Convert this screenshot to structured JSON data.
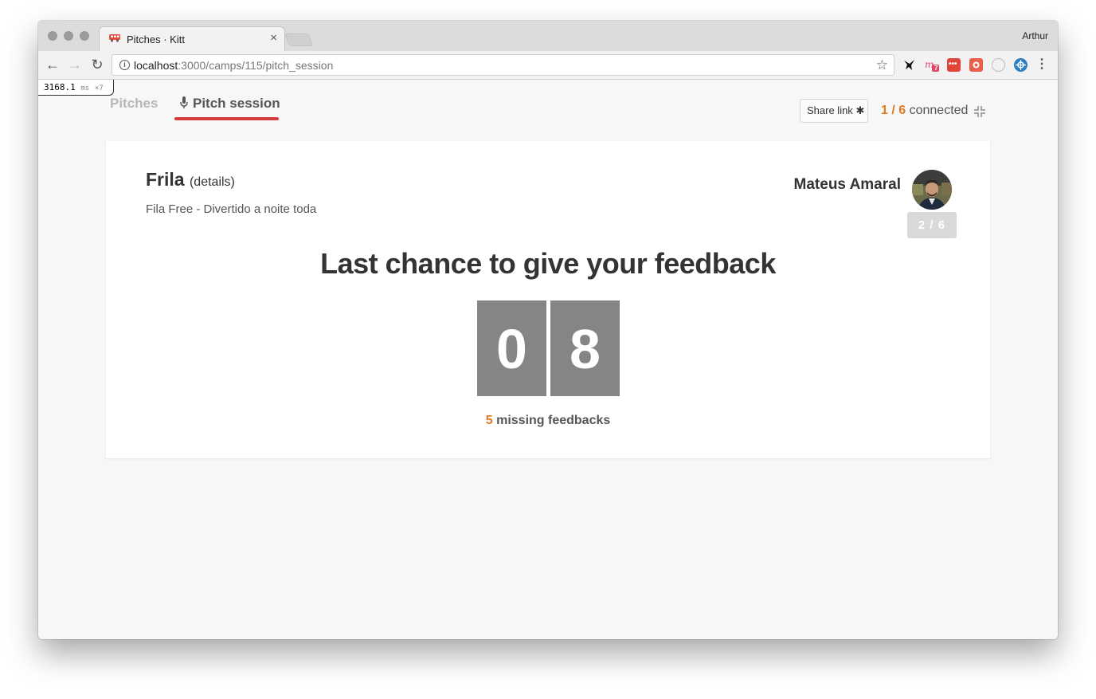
{
  "browser": {
    "tab_title": "Pitches · Kitt",
    "profile_name": "Arthur",
    "url_host": "localhost",
    "url_path": ":3000/camps/115/pitch_session",
    "extension_badge": "7"
  },
  "devtools": {
    "timing_value": "3168.1",
    "timing_unit": "ms",
    "timing_multiplier": "×7"
  },
  "page_nav": {
    "tabs": [
      {
        "label": "Pitches"
      },
      {
        "label": "Pitch session",
        "active": true
      }
    ],
    "share_label": "Share link",
    "connected_count": "1 / 6",
    "connected_label": "connected"
  },
  "pitch": {
    "startup_name": "Frila",
    "details_label": "(details)",
    "tagline": "Fila Free - Divertido a noite toda",
    "presenter_name": "Mateus Amaral",
    "order": "2 / 6",
    "headline": "Last chance to give your feedback",
    "countdown_digits": [
      "0",
      "8"
    ],
    "missing_count": "5",
    "missing_label": "missing feedbacks"
  },
  "colors": {
    "accent_orange": "#e07b22",
    "tab_underline_red": "#d63b3b",
    "countdown_gray": "#858585"
  }
}
